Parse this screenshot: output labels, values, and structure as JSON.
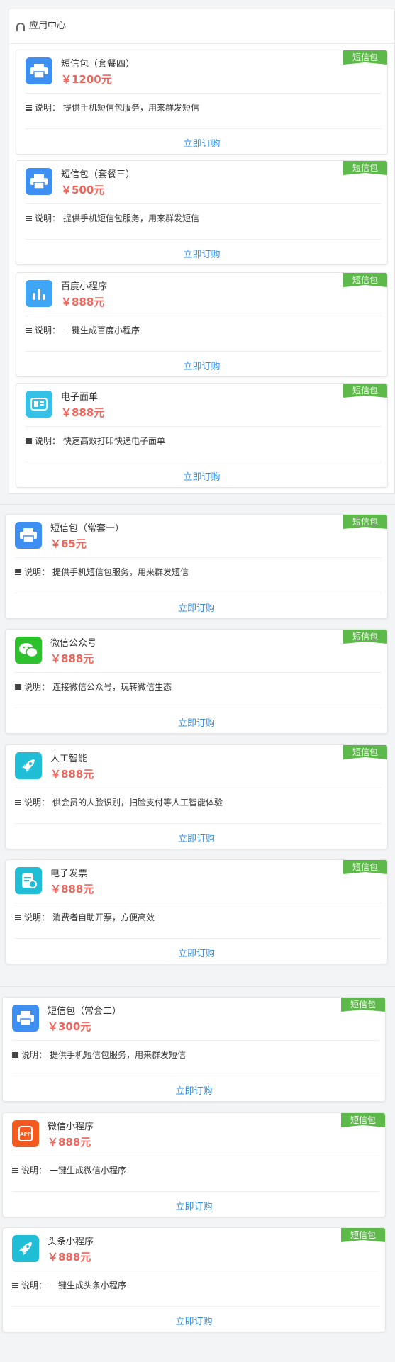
{
  "panel": {
    "title": "应用中心",
    "title_icon": "headset-icon"
  },
  "badge_label": "短信包",
  "desc_prefix": "说明：",
  "order_label": "立即订购",
  "colors": {
    "badge": "#5db94a",
    "price": "#f0645b",
    "link": "#2e8de6"
  },
  "items": [
    {
      "name": "短信包（套餐四）",
      "price": "￥1200元",
      "desc": "提供手机短信包服务，用来群发短信",
      "icon": "printer-icon",
      "icon_color": "#3d8ff2"
    },
    {
      "name": "短信包（套餐三）",
      "price": "￥500元",
      "desc": "提供手机短信包服务，用来群发短信",
      "icon": "printer-icon",
      "icon_color": "#3d8ff2"
    },
    {
      "name": "百度小程序",
      "price": "￥888元",
      "desc": "一键生成百度小程序",
      "icon": "bar-chart-icon",
      "icon_color": "#3fa6f5"
    },
    {
      "name": "电子面单",
      "price": "￥888元",
      "desc": "快速高效打印快递电子面单",
      "icon": "waybill-icon",
      "icon_color": "#35c1e6"
    },
    {
      "name": "短信包（常套一）",
      "price": "￥65元",
      "desc": "提供手机短信包服务，用来群发短信",
      "icon": "printer-icon",
      "icon_color": "#3d8ff2"
    },
    {
      "name": "微信公众号",
      "price": "￥888元",
      "desc": "连接微信公众号，玩转微信生态",
      "icon": "wechat-icon",
      "icon_color": "#2ec12e"
    },
    {
      "name": "人工智能",
      "price": "￥888元",
      "desc": "供会员的人脸识别，扫脸支付等人工智能体验",
      "icon": "rocket-icon",
      "icon_color": "#1fbdd6"
    },
    {
      "name": "电子发票",
      "price": "￥888元",
      "desc": "消费者自助开票，方便高效",
      "icon": "invoice-icon",
      "icon_color": "#1fbdd6"
    },
    {
      "name": "短信包（常套二）",
      "price": "￥300元",
      "desc": "提供手机短信包服务，用来群发短信",
      "icon": "printer-icon",
      "icon_color": "#3d8ff2"
    },
    {
      "name": "微信小程序",
      "price": "￥888元",
      "desc": "一键生成微信小程序",
      "icon": "app-icon",
      "icon_color": "#f25a1f"
    },
    {
      "name": "头条小程序",
      "price": "￥888元",
      "desc": "一键生成头条小程序",
      "icon": "rocket-icon",
      "icon_color": "#1fbdd6"
    }
  ]
}
